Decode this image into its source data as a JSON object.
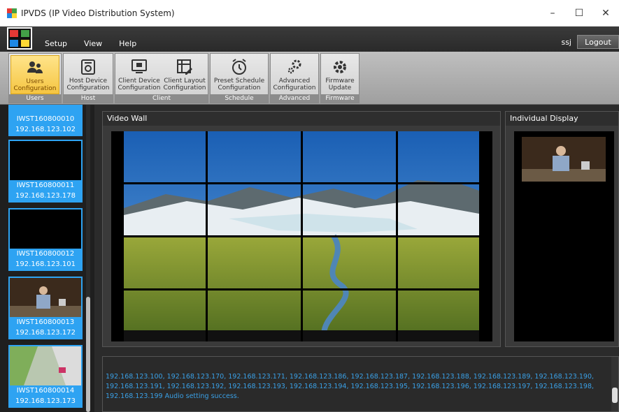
{
  "window": {
    "title": "IPVDS (IP Video Distribution System)",
    "minimize": "–",
    "maximize": "☐",
    "close": "✕"
  },
  "menu": {
    "items": [
      "Setup",
      "View",
      "Help"
    ],
    "user": "ssj",
    "logout": "Logout"
  },
  "ribbon": {
    "groups": [
      {
        "name": "Users",
        "buttons": [
          {
            "line1": "Users",
            "line2": "Configuration",
            "icon": "users-icon"
          }
        ]
      },
      {
        "name": "Host",
        "buttons": [
          {
            "line1": "Host Device",
            "line2": "Configuration",
            "icon": "host-device-icon"
          }
        ]
      },
      {
        "name": "Client",
        "buttons": [
          {
            "line1": "Client Device",
            "line2": "Configuration",
            "icon": "client-device-icon"
          },
          {
            "line1": "Client Layout",
            "line2": "Configuration",
            "icon": "client-layout-icon"
          }
        ]
      },
      {
        "name": "Schedule",
        "buttons": [
          {
            "line1": "Preset Schedule",
            "line2": "Configuration",
            "icon": "alarm-clock-icon"
          }
        ]
      },
      {
        "name": "Advanced",
        "buttons": [
          {
            "line1": "Advanced",
            "line2": "Configuration",
            "icon": "gears-icon"
          }
        ]
      },
      {
        "name": "Firmware",
        "buttons": [
          {
            "line1": "Firmware",
            "line2": "Update",
            "icon": "gear-icon"
          }
        ]
      }
    ]
  },
  "devices": [
    {
      "name": "IWST160800010",
      "ip": "192.168.123.102"
    },
    {
      "name": "IWST160800011",
      "ip": "192.168.123.178"
    },
    {
      "name": "IWST160800012",
      "ip": "192.168.123.101"
    },
    {
      "name": "IWST160800013",
      "ip": "192.168.123.172"
    },
    {
      "name": "IWST160800014",
      "ip": "192.168.123.173"
    }
  ],
  "video_wall": {
    "title": "Video Wall"
  },
  "individual_display": {
    "title": "Individual Display"
  },
  "log": {
    "text": "192.168.123.100, 192.168.123.170, 192.168.123.171, 192.168.123.186, 192.168.123.187, 192.168.123.188, 192.168.123.189, 192.168.123.190, 192.168.123.191, 192.168.123.192, 192.168.123.193, 192.168.123.194, 192.168.123.195, 192.168.123.196, 192.168.123.197, 192.168.123.198, 192.168.123.199 Audio setting success."
  },
  "colors": {
    "accent": "#2ea3f2",
    "active_ribbon": "#f5c542",
    "log_text": "#3aa0e6"
  }
}
